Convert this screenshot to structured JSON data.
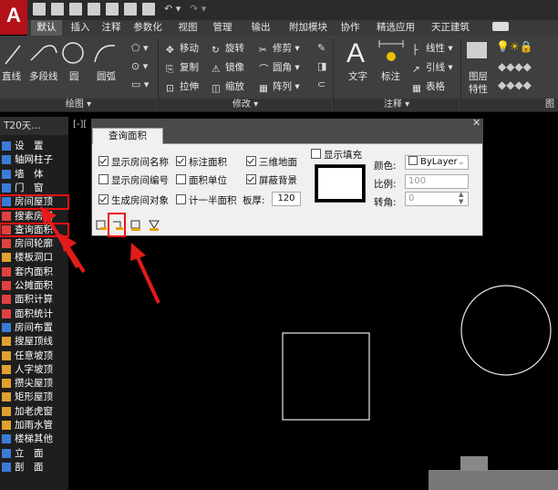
{
  "app": {
    "logo_letter": "A"
  },
  "tabs": [
    "默认",
    "插入",
    "注释",
    "参数化",
    "视图",
    "管理",
    "输出",
    "附加模块",
    "协作",
    "精选应用",
    "天正建筑"
  ],
  "active_tab": "默认",
  "ribbon": {
    "draw": {
      "items": [
        "直线",
        "多段线",
        "圆",
        "圆弧"
      ],
      "panel": "绘图 ▾"
    },
    "modify": {
      "rows": [
        [
          "移动",
          "旋转",
          "修剪"
        ],
        [
          "复制",
          "镜像",
          "圆角"
        ],
        [
          "拉伸",
          "缩放",
          "阵列"
        ]
      ],
      "panel": "修改 ▾"
    },
    "annotate": {
      "items": [
        "文字",
        "标注"
      ],
      "small": [
        "线性",
        "引线",
        "表格"
      ],
      "panel": "注释 ▾"
    },
    "layer": {
      "label_1": "图层",
      "label_2": "特性",
      "panel": "图"
    }
  },
  "left_panel": {
    "title": "T20天...",
    "items": [
      {
        "label": "设　置",
        "color": "#3a7bd5",
        "hl": false
      },
      {
        "label": "轴网柱子",
        "color": "#3a7bd5",
        "hl": false
      },
      {
        "label": "墙　体",
        "color": "#3a7bd5",
        "hl": false
      },
      {
        "label": "门　窗",
        "color": "#3a7bd5",
        "hl": false
      },
      {
        "label": "房间屋顶",
        "color": "#3a7bd5",
        "hl": true
      },
      {
        "label": "搜索房间",
        "color": "#e04040",
        "hl": false
      },
      {
        "label": "查询面积",
        "color": "#e04040",
        "hl": true
      },
      {
        "label": "房间轮廓",
        "color": "#e04040",
        "hl": false
      },
      {
        "label": "楼板洞口",
        "color": "#e0a030",
        "hl": false
      },
      {
        "label": "套内面积",
        "color": "#e04040",
        "hl": false
      },
      {
        "label": "公摊面积",
        "color": "#e04040",
        "hl": false
      },
      {
        "label": "面积计算",
        "color": "#e04040",
        "hl": false
      },
      {
        "label": "面积统计",
        "color": "#e04040",
        "hl": false
      },
      {
        "label": "房间布置",
        "color": "#3a7bd5",
        "hl": false
      },
      {
        "label": "搜屋顶线",
        "color": "#e0a030",
        "hl": false
      },
      {
        "label": "任意坡顶",
        "color": "#e0a030",
        "hl": false
      },
      {
        "label": "人字坡顶",
        "color": "#e0a030",
        "hl": false
      },
      {
        "label": "攒尖屋顶",
        "color": "#e0a030",
        "hl": false
      },
      {
        "label": "矩形屋顶",
        "color": "#e0a030",
        "hl": false
      },
      {
        "label": "加老虎窗",
        "color": "#e0a030",
        "hl": false
      },
      {
        "label": "加雨水管",
        "color": "#e0a030",
        "hl": false
      },
      {
        "label": "楼梯其他",
        "color": "#3a7bd5",
        "hl": false
      },
      {
        "label": "立　面",
        "color": "#3a7bd5",
        "hl": false
      },
      {
        "label": "剖　面",
        "color": "#3a7bd5",
        "hl": false
      }
    ]
  },
  "viewport": {
    "label": "[-]["
  },
  "dialog": {
    "tab": "查询面积",
    "options": {
      "show_room_name": {
        "label": "显示房间名称",
        "checked": true
      },
      "show_room_number": {
        "label": "显示房间编号",
        "checked": false
      },
      "gen_room_object": {
        "label": "生成房间对象",
        "checked": true
      },
      "mark_area": {
        "label": "标注面积",
        "checked": true
      },
      "area_unit": {
        "label": "面积单位",
        "checked": false
      },
      "count_half_area": {
        "label": "计一半面积",
        "checked": false
      },
      "3d_floor": {
        "label": "三维地面",
        "checked": true
      },
      "mask_bg": {
        "label": "屏蔽背景",
        "checked": true
      },
      "show_fill": {
        "label": "显示填充",
        "checked": false
      }
    },
    "slab_thickness": {
      "label": "板厚:",
      "value": "120"
    },
    "color": {
      "label": "颜色:",
      "value": "ByLayer"
    },
    "scale": {
      "label": "比例:",
      "value": "100"
    },
    "angle": {
      "label": "转角:",
      "value": "0"
    }
  }
}
